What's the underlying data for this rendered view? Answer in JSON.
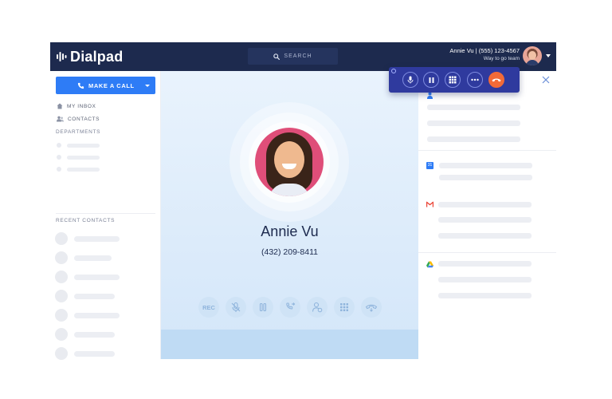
{
  "app": {
    "name": "Dialpad"
  },
  "header": {
    "search_label": "SEARCH",
    "user_name": "Annie Vu | (555) 123-4567",
    "user_team": "Way to go team"
  },
  "sidebar": {
    "make_call_label": "MAKE A CALL",
    "nav": [
      {
        "label": "MY INBOX",
        "icon": "home-icon"
      },
      {
        "label": "CONTACTS",
        "icon": "contacts-icon"
      }
    ],
    "departments_label": "DEPARTMENTS",
    "recent_contacts_label": "RECENT CONTACTS"
  },
  "call": {
    "caller_name": "Annie Vu",
    "caller_number": "(432) 209-8411",
    "controls": [
      {
        "name": "record",
        "label": "REC",
        "icon": "record-icon"
      },
      {
        "name": "mute",
        "label": "",
        "icon": "microphone-off-icon"
      },
      {
        "name": "hold",
        "label": "",
        "icon": "pause-icon"
      },
      {
        "name": "transfer",
        "label": "",
        "icon": "transfer-icon"
      },
      {
        "name": "add-caller",
        "label": "",
        "icon": "add-person-icon"
      },
      {
        "name": "keypad",
        "label": "",
        "icon": "keypad-icon"
      },
      {
        "name": "hangup",
        "label": "",
        "icon": "hangup-icon"
      }
    ]
  },
  "right_panel": {
    "integrations": [
      {
        "name": "calendar",
        "icon": "calendar-icon",
        "label": "31"
      },
      {
        "name": "gmail",
        "icon": "gmail-icon"
      },
      {
        "name": "drive",
        "icon": "google-drive-icon"
      }
    ]
  },
  "colors": {
    "header_bg": "#1d2a4e",
    "accent_blue": "#2e7cf6",
    "float_bar_bg": "#2f3a9e",
    "end_call": "#f26a38",
    "caller_photo_bg": "#df4e79"
  }
}
